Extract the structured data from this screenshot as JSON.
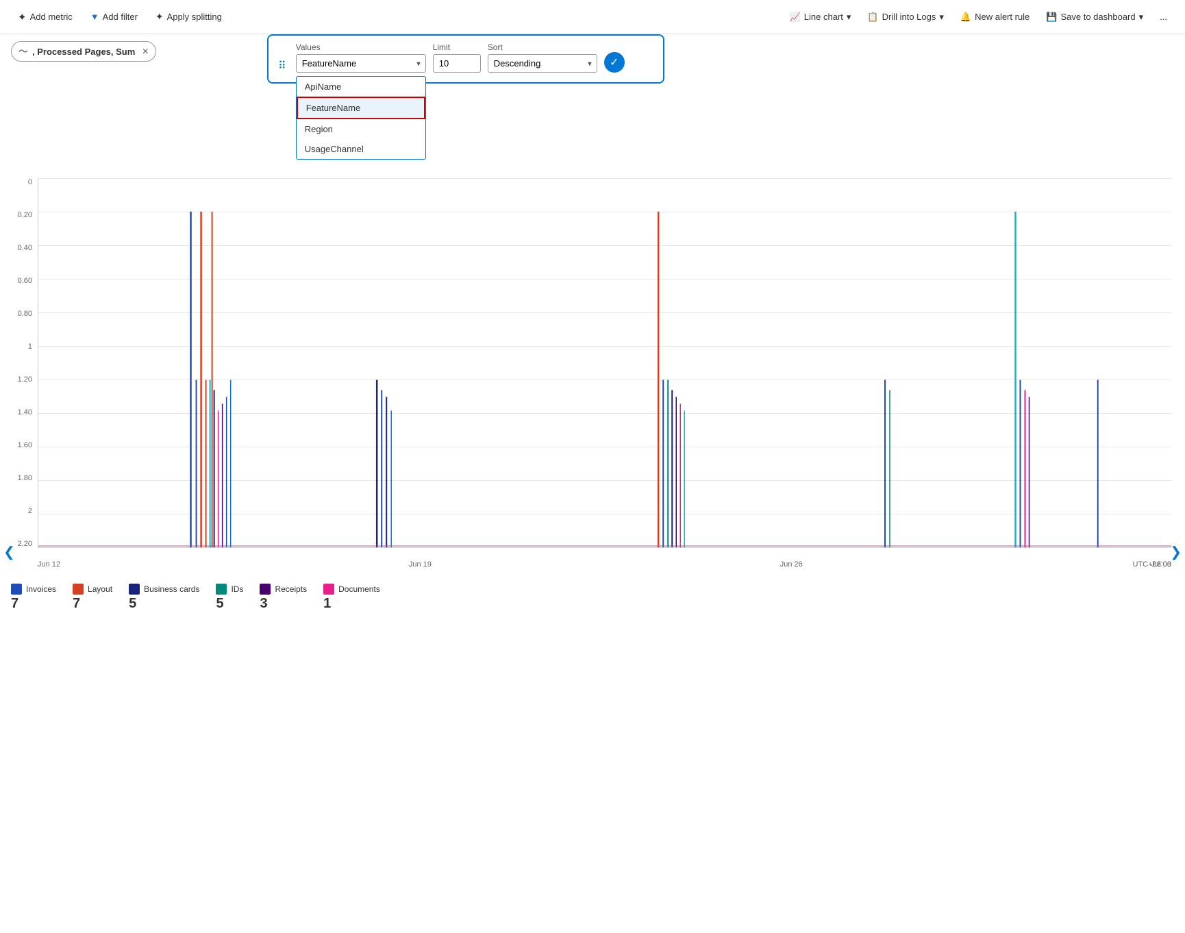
{
  "toolbar": {
    "add_metric": "Add metric",
    "add_filter": "Add filter",
    "apply_splitting": "Apply splitting",
    "line_chart": "Line chart",
    "drill_into_logs": "Drill into Logs",
    "new_alert_rule": "New alert rule",
    "save_to_dashboard": "Save to dashboard",
    "more_options": "..."
  },
  "metric_chip": {
    "label": ", Processed Pages, Sum"
  },
  "splitting_panel": {
    "values_label": "Values",
    "limit_label": "Limit",
    "sort_label": "Sort",
    "selected_value": "FeatureName",
    "limit_value": "10",
    "sort_value": "Descending",
    "dropdown_items": [
      "ApiName",
      "FeatureName",
      "Region",
      "UsageChannel"
    ]
  },
  "chart": {
    "y_labels": [
      "2.20",
      "2",
      "1.80",
      "1.60",
      "1.40",
      "1.20",
      "1",
      "0.80",
      "0.60",
      "0.40",
      "0.20",
      "0"
    ],
    "x_labels": [
      "Jun 12",
      "Jun 19",
      "Jun 26",
      "Jul 03"
    ],
    "timezone": "UTC+08:00"
  },
  "legend": [
    {
      "name": "Invoices",
      "value": "7",
      "color": "#1e4db7"
    },
    {
      "name": "Layout",
      "value": "7",
      "color": "#d44020"
    },
    {
      "name": "Business cards",
      "value": "5",
      "color": "#1a237e"
    },
    {
      "name": "IDs",
      "value": "5",
      "color": "#00897b"
    },
    {
      "name": "Receipts",
      "value": "3",
      "color": "#4a0070"
    },
    {
      "name": "Documents",
      "value": "1",
      "color": "#e91e8c"
    }
  ]
}
